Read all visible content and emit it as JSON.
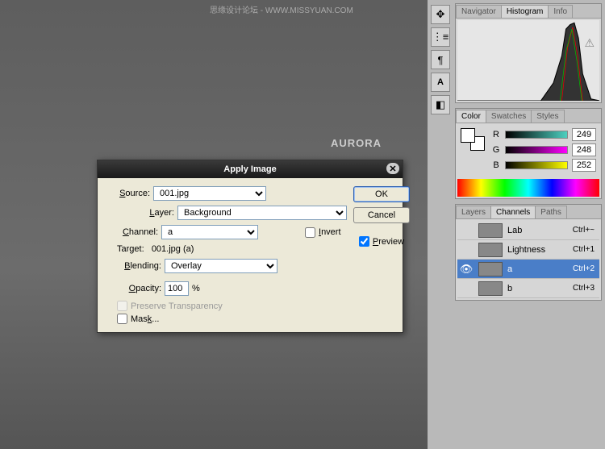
{
  "watermark": "思缘设计论坛 - WWW.MISSYUAN.COM",
  "aurora_text": "AURORA",
  "dialog": {
    "title": "Apply Image",
    "source_label": "Source:",
    "source_value": "001.jpg",
    "layer_label": "Layer:",
    "layer_value": "Background",
    "channel_label": "Channel:",
    "channel_value": "a",
    "invert_label": "Invert",
    "target_label": "Target:",
    "target_value": "001.jpg (a)",
    "blending_label": "Blending:",
    "blending_value": "Overlay",
    "opacity_label": "Opacity:",
    "opacity_value": "100",
    "opacity_unit": "%",
    "preserve_label": "Preserve Transparency",
    "mask_label": "Mask...",
    "ok": "OK",
    "cancel": "Cancel",
    "preview": "Preview"
  },
  "nav": {
    "tabs": [
      "Navigator",
      "Histogram",
      "Info"
    ]
  },
  "color": {
    "tabs": [
      "Color",
      "Swatches",
      "Styles"
    ],
    "r_label": "R",
    "r_val": "249",
    "g_label": "G",
    "g_val": "248",
    "b_label": "B",
    "b_val": "252"
  },
  "channels": {
    "tabs": [
      "Layers",
      "Channels",
      "Paths"
    ],
    "rows": [
      {
        "name": "Lab",
        "shortcut": "Ctrl+~",
        "eye": ""
      },
      {
        "name": "Lightness",
        "shortcut": "Ctrl+1",
        "eye": ""
      },
      {
        "name": "a",
        "shortcut": "Ctrl+2",
        "eye": "👁",
        "selected": true
      },
      {
        "name": "b",
        "shortcut": "Ctrl+3",
        "eye": ""
      }
    ]
  }
}
